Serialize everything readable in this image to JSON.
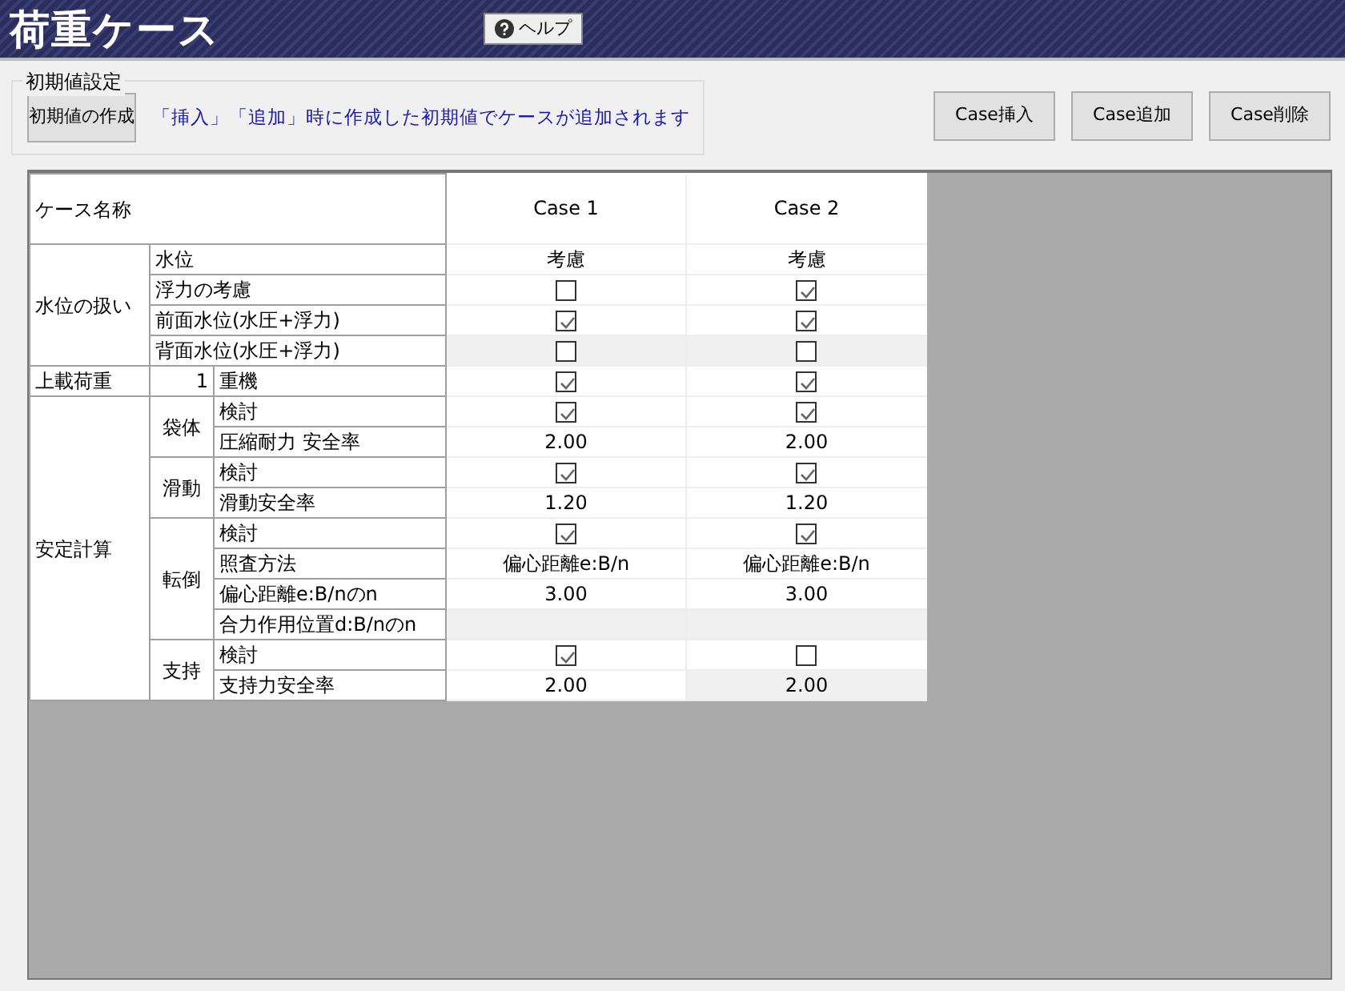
{
  "header": {
    "title": "荷重ケース",
    "help_button": "ヘルプ"
  },
  "initial_settings": {
    "legend": "初期値設定",
    "create_button": "初期値の作成",
    "note": "「挿入」「追加」時に作成した初期値でケースが追加されます"
  },
  "buttons": [
    "Case挿入",
    "Case追加",
    "Case削除"
  ],
  "table": {
    "header_label": "ケース名称",
    "cases": [
      "Case 1",
      "Case 2"
    ],
    "groups": [
      {
        "label": "水位の扱い",
        "subgroups": [
          {
            "kind": "none",
            "rows": [
              {
                "label": "水位",
                "cells": [
                  {
                    "kind": "text",
                    "text": "考慮",
                    "disabled": false
                  },
                  {
                    "kind": "text",
                    "text": "考慮",
                    "disabled": false
                  }
                ]
              },
              {
                "label": "浮力の考慮",
                "cells": [
                  {
                    "kind": "check",
                    "checked": false,
                    "disabled": false
                  },
                  {
                    "kind": "check",
                    "checked": true,
                    "disabled": false
                  }
                ]
              },
              {
                "label": "前面水位(水圧+浮力)",
                "cells": [
                  {
                    "kind": "check",
                    "checked": true,
                    "disabled": false
                  },
                  {
                    "kind": "check",
                    "checked": true,
                    "disabled": false
                  }
                ]
              },
              {
                "label": "背面水位(水圧+浮力)",
                "cells": [
                  {
                    "kind": "check",
                    "checked": false,
                    "disabled": true
                  },
                  {
                    "kind": "check",
                    "checked": false,
                    "disabled": true
                  }
                ]
              }
            ]
          }
        ]
      },
      {
        "label": "上載荷重",
        "subgroups": [
          {
            "kind": "number",
            "label": "1",
            "rows": [
              {
                "label": "重機",
                "cells": [
                  {
                    "kind": "check",
                    "checked": true,
                    "disabled": false
                  },
                  {
                    "kind": "check",
                    "checked": true,
                    "disabled": false
                  }
                ]
              }
            ]
          }
        ]
      },
      {
        "label": "安定計算",
        "subgroups": [
          {
            "kind": "name",
            "label": "袋体",
            "rows": [
              {
                "label": "検討",
                "cells": [
                  {
                    "kind": "check",
                    "checked": true,
                    "disabled": false
                  },
                  {
                    "kind": "check",
                    "checked": true,
                    "disabled": false
                  }
                ]
              },
              {
                "label": "圧縮耐力 安全率",
                "cells": [
                  {
                    "kind": "text",
                    "text": "2.00",
                    "disabled": false
                  },
                  {
                    "kind": "text",
                    "text": "2.00",
                    "disabled": false
                  }
                ]
              }
            ]
          },
          {
            "kind": "name",
            "label": "滑動",
            "rows": [
              {
                "label": "検討",
                "cells": [
                  {
                    "kind": "check",
                    "checked": true,
                    "disabled": false
                  },
                  {
                    "kind": "check",
                    "checked": true,
                    "disabled": false
                  }
                ]
              },
              {
                "label": "滑動安全率",
                "cells": [
                  {
                    "kind": "text",
                    "text": "1.20",
                    "disabled": false
                  },
                  {
                    "kind": "text",
                    "text": "1.20",
                    "disabled": false
                  }
                ]
              }
            ]
          },
          {
            "kind": "name",
            "label": "転倒",
            "rows": [
              {
                "label": "検討",
                "cells": [
                  {
                    "kind": "check",
                    "checked": true,
                    "disabled": false
                  },
                  {
                    "kind": "check",
                    "checked": true,
                    "disabled": false
                  }
                ]
              },
              {
                "label": "照査方法",
                "cells": [
                  {
                    "kind": "text",
                    "text": "偏心距離e:B/n",
                    "disabled": false
                  },
                  {
                    "kind": "text",
                    "text": "偏心距離e:B/n",
                    "disabled": false
                  }
                ]
              },
              {
                "label": "偏心距離e:B/nのn",
                "cells": [
                  {
                    "kind": "text",
                    "text": "3.00",
                    "disabled": false
                  },
                  {
                    "kind": "text",
                    "text": "3.00",
                    "disabled": false
                  }
                ]
              },
              {
                "label": "合力作用位置d:B/nのn",
                "cells": [
                  {
                    "kind": "blank",
                    "disabled": true
                  },
                  {
                    "kind": "blank",
                    "disabled": true
                  }
                ]
              }
            ]
          },
          {
            "kind": "name",
            "label": "支持",
            "rows": [
              {
                "label": "検討",
                "cells": [
                  {
                    "kind": "check",
                    "checked": true,
                    "disabled": false
                  },
                  {
                    "kind": "check",
                    "checked": false,
                    "disabled": false
                  }
                ]
              },
              {
                "label": "支持力安全率",
                "cells": [
                  {
                    "kind": "text",
                    "text": "2.00",
                    "disabled": false
                  },
                  {
                    "kind": "text",
                    "text": "2.00",
                    "disabled": true
                  }
                ]
              }
            ]
          }
        ]
      }
    ]
  }
}
